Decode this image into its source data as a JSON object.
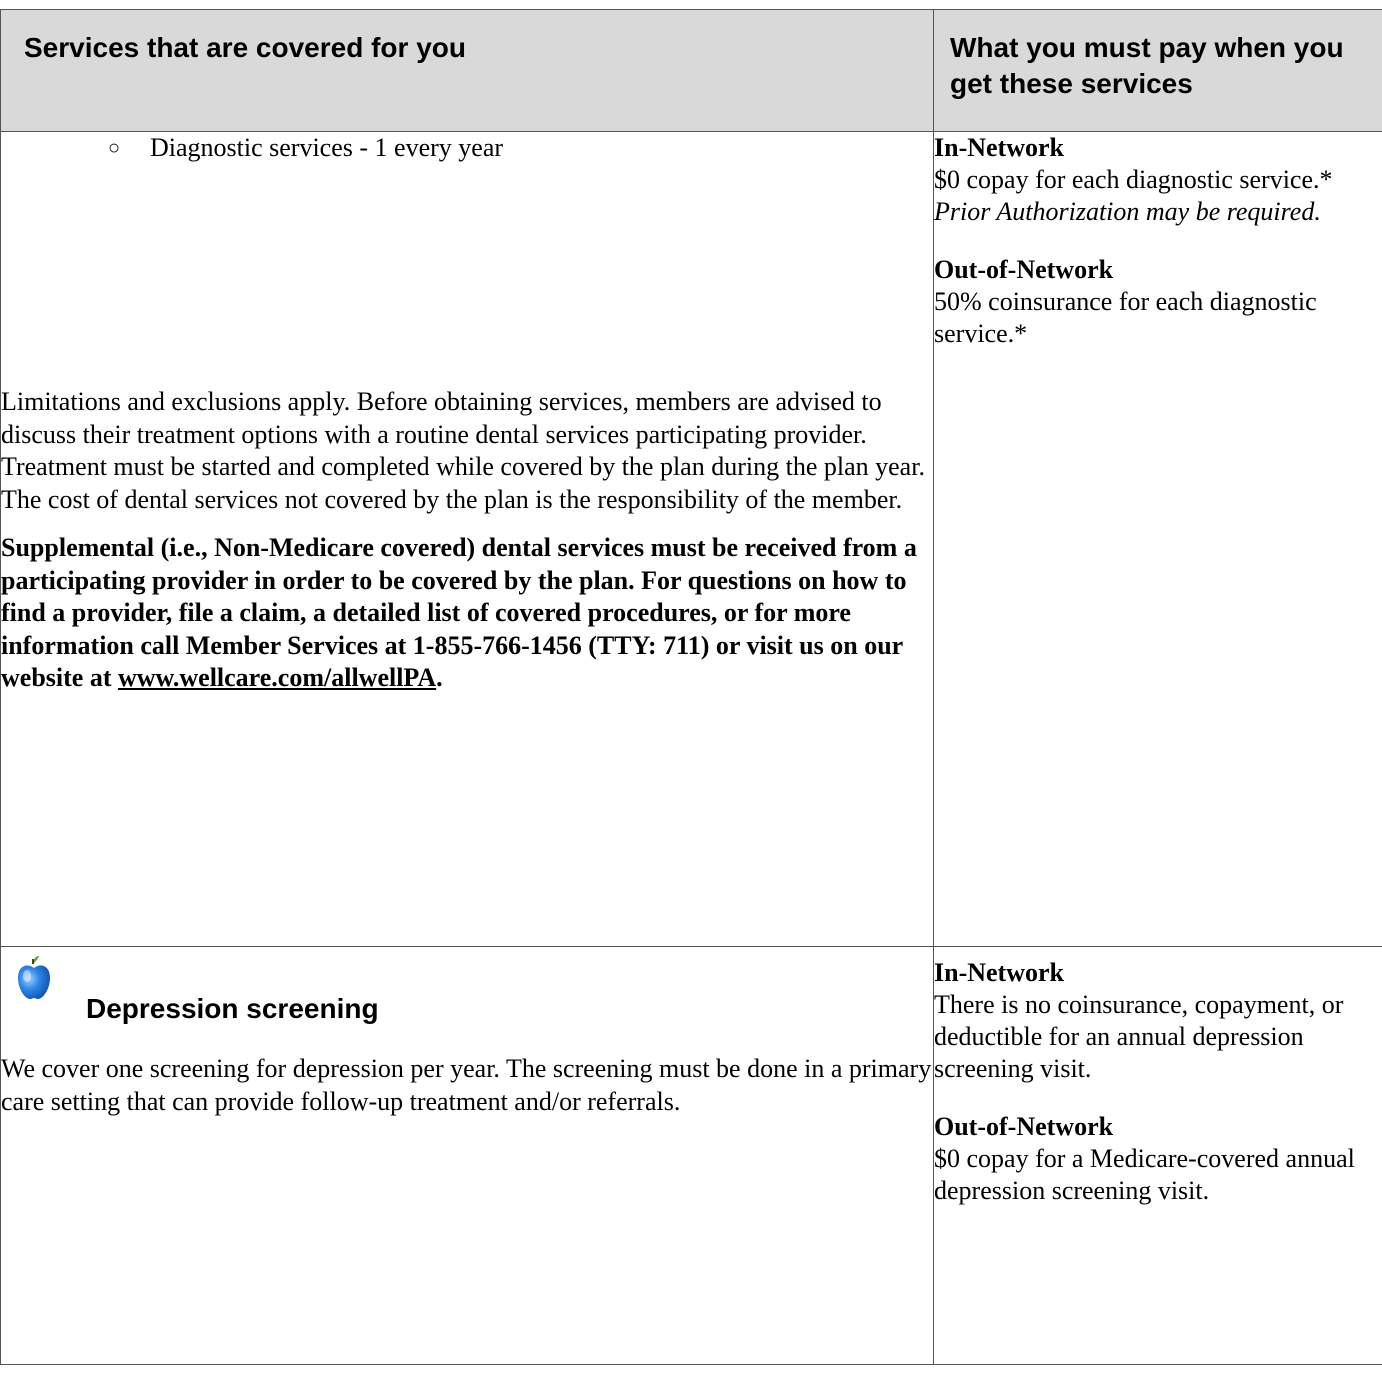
{
  "header": {
    "left": "Services that are covered for you",
    "right": "What you must pay when you get these services"
  },
  "dental": {
    "bullet_symbol": "○",
    "bullet_text": "Diagnostic services - 1 every year",
    "limitations": "Limitations and exclusions apply. Before obtaining services, members are advised to discuss their treatment options with a routine dental services participating provider. Treatment must be started and completed while covered by the plan during the plan year. The cost of dental services not covered by the plan is the responsibility of the member.",
    "supplemental": "Supplemental (i.e., Non-Medicare covered) dental services must be received from a participating provider in order to be covered by the plan. For questions on how to find a provider, file a claim, a detailed list of covered procedures, or for more information call Member Services at 1-855-766-1456 (TTY: 711) or visit us on our website at ",
    "website": "www.wellcare.com/allwellPA",
    "website_suffix": ".",
    "in_network_title": "In-Network",
    "in_network_text": "$0 copay for each diagnostic service.*",
    "in_network_note": "Prior Authorization may be required.",
    "out_network_title": "Out-of-Network",
    "out_network_text": "50% coinsurance for each diagnostic service.*"
  },
  "depression": {
    "icon": "apple-icon",
    "title": "Depression screening",
    "description": "We cover one screening for depression per year. The screening must be done in a primary care setting that can provide follow-up treatment and/or referrals.",
    "in_network_title": "In-Network",
    "in_network_text": "There is no coinsurance, copayment, or deductible for an annual depression screening visit.",
    "out_network_title": "Out-of-Network",
    "out_network_text": "$0 copay for a Medicare-covered annual depression screening visit."
  },
  "colors": {
    "header_bg": "#d9d9d9",
    "border": "#555555",
    "apple_blue": "#1a6fd1"
  }
}
